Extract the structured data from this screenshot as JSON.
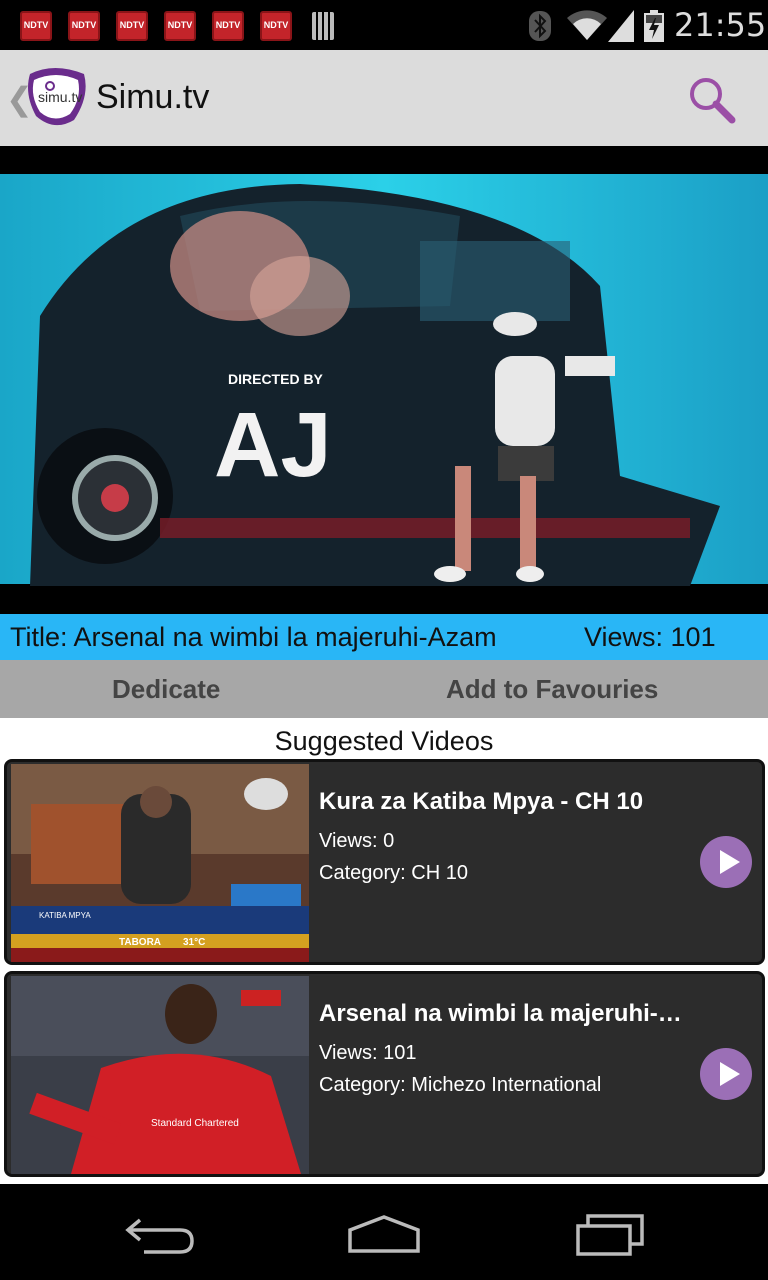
{
  "status": {
    "notification_label": "NDTV",
    "notification_count": 6,
    "time": "21:55"
  },
  "app": {
    "logo_text": "simu.tv",
    "title": "Simu.tv"
  },
  "video": {
    "overlay_small": "DIRECTED BY",
    "overlay_large": "AJ"
  },
  "info": {
    "title": "Title: Arsenal na wimbi la majeruhi-Azam",
    "views": "Views: 101"
  },
  "actions": {
    "dedicate": "Dedicate",
    "favourites": "Add to Favouries"
  },
  "suggested": {
    "heading": "Suggested Videos",
    "items": [
      {
        "title": "Kura za Katiba Mpya - CH 10",
        "views": "Views: 0",
        "category": "Category: CH 10",
        "thumb_text_1": "KATIBA MPYA",
        "thumb_text_2": "TABORA",
        "thumb_text_3": "31°C"
      },
      {
        "title": "Arsenal na wimbi la majeruhi-Azam",
        "views": "Views: 101",
        "category": "Category: Michezo International",
        "thumb_text_1": "Standard Chartered"
      }
    ]
  },
  "colors": {
    "accent_blue": "#29b6f6",
    "brand_purple": "#7b3f98",
    "play_purple": "#9b6fb6"
  }
}
